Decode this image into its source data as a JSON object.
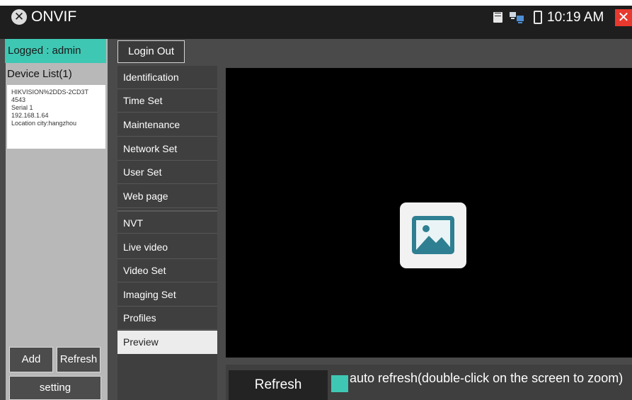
{
  "app": {
    "title": "ONVIF",
    "logo_glyph": "✕"
  },
  "status_bar": {
    "time": "10:19 AM",
    "icons": [
      "sd-card-icon",
      "network-icon",
      "battery-icon"
    ],
    "close_glyph": "✕"
  },
  "session": {
    "logged_text": "Logged : admin",
    "logout_label": "Login Out"
  },
  "device_list": {
    "title": "Device List(1)",
    "devices": [
      {
        "lines": [
          "HIKVISION%2DDS-2CD3T",
          "4543",
          "Serial 1",
          "192.168.1.64",
          "Location city:hangzhou"
        ]
      }
    ],
    "add_label": "Add",
    "refresh_label": "Refresh",
    "setting_label": "setting"
  },
  "menu": {
    "items": [
      {
        "label": "Identification"
      },
      {
        "label": "Time Set"
      },
      {
        "label": "Maintenance"
      },
      {
        "label": "Network Set"
      },
      {
        "label": "User Set"
      },
      {
        "label": "Web page"
      },
      {
        "label": "NVT"
      },
      {
        "label": "Live video"
      },
      {
        "label": "Video Set"
      },
      {
        "label": "Imaging Set"
      },
      {
        "label": "Profiles"
      },
      {
        "label": "Preview",
        "selected": true
      }
    ]
  },
  "preview": {
    "placeholder_icon": "image-placeholder-icon",
    "refresh_label": "Refresh",
    "auto_refresh_label": "auto refresh(double-click on the screen to zoom)",
    "auto_refresh_checked": true
  },
  "colors": {
    "accent": "#3ec8b4",
    "topbar": "#1e1e1e",
    "panel": "#4a4a4a",
    "preview_bg": "#000000",
    "close": "#e8392e"
  }
}
